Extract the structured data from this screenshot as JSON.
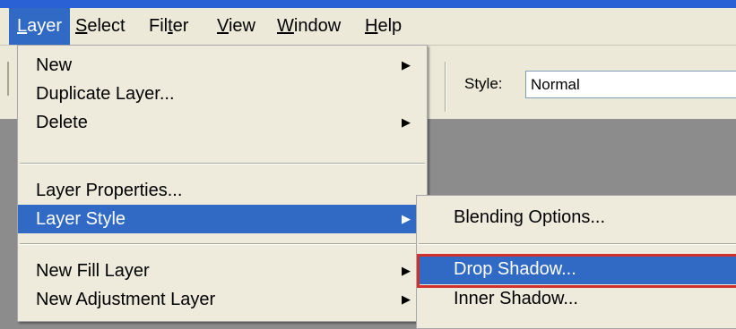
{
  "menubar": {
    "items": [
      {
        "label": "Layer",
        "ul": "L",
        "rest": "ayer"
      },
      {
        "label": "Select",
        "ul": "S",
        "rest": "elect"
      },
      {
        "label": "Filter",
        "pre": "Fil",
        "ul": "t",
        "rest": "er"
      },
      {
        "label": "View",
        "ul": "V",
        "rest": "iew"
      },
      {
        "label": "Window",
        "ul": "W",
        "rest": "indow"
      },
      {
        "label": "Help",
        "ul": "H",
        "rest": "elp"
      }
    ]
  },
  "options_bar": {
    "style_label": "Style:",
    "style_value": "Normal"
  },
  "layer_menu": {
    "items": [
      {
        "label": "New"
      },
      {
        "label": "Duplicate Layer..."
      },
      {
        "label": "Delete"
      },
      {
        "label": "Layer Properties..."
      },
      {
        "label": "Layer Style"
      },
      {
        "label": "New Fill Layer"
      },
      {
        "label": "New Adjustment Layer"
      }
    ]
  },
  "layer_style_submenu": {
    "items": [
      {
        "label": "Blending Options..."
      },
      {
        "label": "Drop Shadow..."
      },
      {
        "label": "Inner Shadow..."
      }
    ]
  },
  "colors": {
    "highlight": "#316ac5",
    "callout": "#d0312d",
    "menu_bg": "#eeebdd"
  },
  "icons": {
    "submenu_arrow": "triangle-right"
  }
}
